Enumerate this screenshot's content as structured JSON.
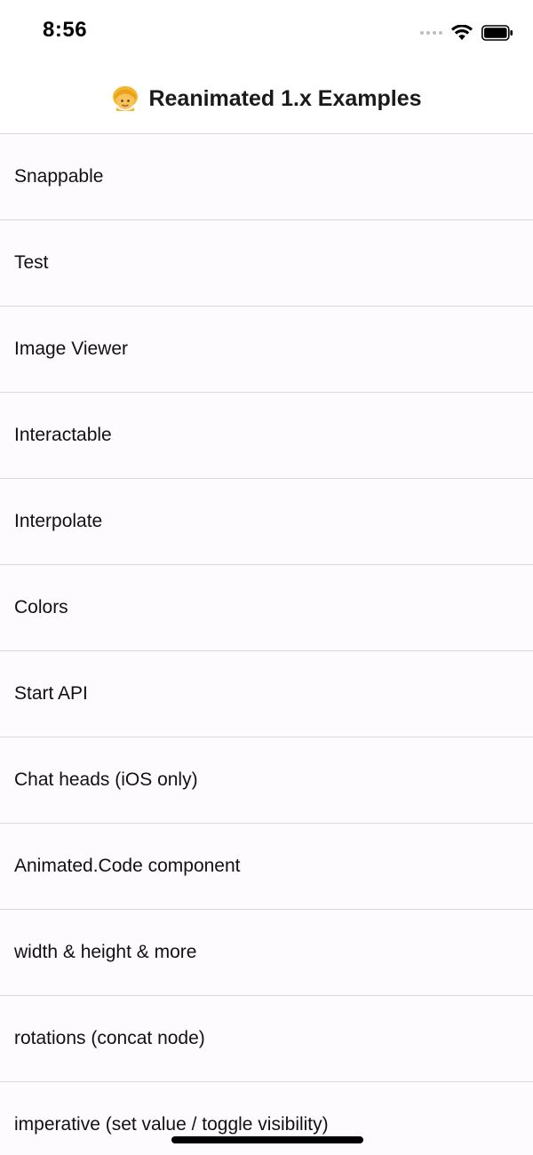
{
  "status_bar": {
    "time": "8:56"
  },
  "header": {
    "emoji_icon": "person-with-headscarf-icon",
    "title": "Reanimated 1.x Examples"
  },
  "list": {
    "items": [
      {
        "label": "Snappable"
      },
      {
        "label": "Test"
      },
      {
        "label": "Image Viewer"
      },
      {
        "label": "Interactable"
      },
      {
        "label": "Interpolate"
      },
      {
        "label": "Colors"
      },
      {
        "label": "Start API"
      },
      {
        "label": "Chat heads (iOS only)"
      },
      {
        "label": "Animated.Code component"
      },
      {
        "label": "width & height & more"
      },
      {
        "label": "rotations (concat node)"
      },
      {
        "label": "imperative (set value / toggle visibility)"
      }
    ]
  },
  "colors": {
    "background": "#fdfbfe",
    "header_background": "#ffffff",
    "separator": "#d9d9d9"
  }
}
